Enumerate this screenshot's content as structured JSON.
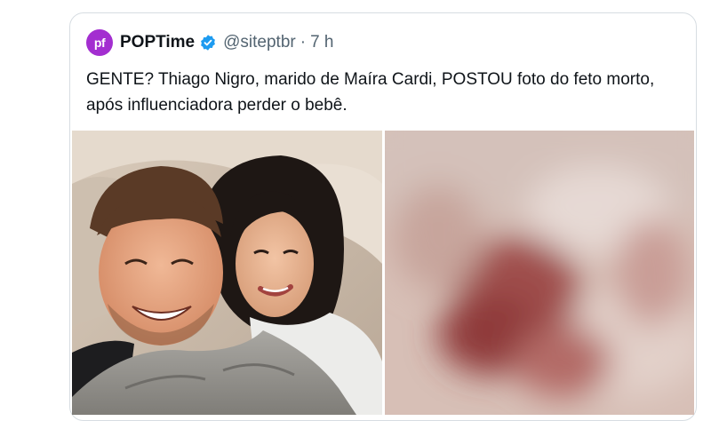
{
  "tweet": {
    "avatar_text": "pf",
    "display_name": "POPTime",
    "handle": "@siteptbr",
    "separator": "·",
    "time": "7 h",
    "text": "GENTE? Thiago Nigro, marido de Maíra Cardi, POSTOU foto do feto morto, após influenciadora perder o bebê.",
    "icons": {
      "verified": "verified-badge-icon"
    },
    "colors": {
      "avatar_bg": "#a32ed0",
      "verified": "#1d9bf0",
      "handle_text": "#536471",
      "body_text": "#0f1419",
      "border": "#d7dde2"
    }
  },
  "media": {
    "images": [
      {
        "name": "couple-selfie-photo"
      },
      {
        "name": "blurred-sensitive-photo"
      }
    ]
  }
}
